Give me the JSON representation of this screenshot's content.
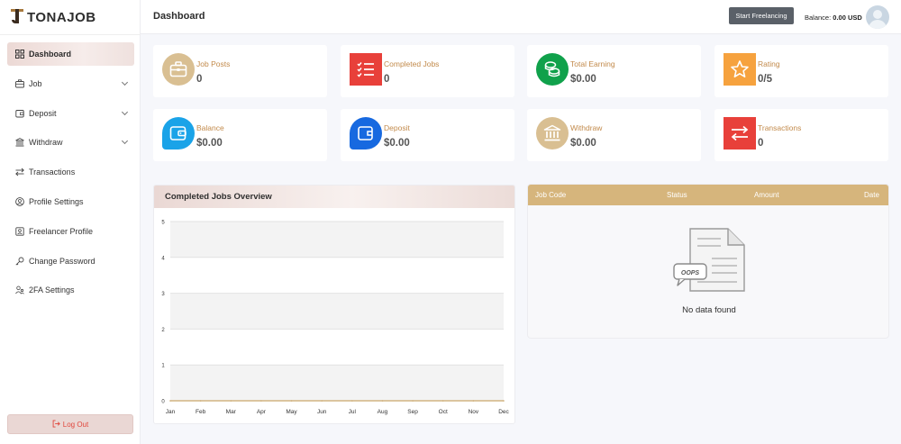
{
  "app": {
    "logo_text": "TONAJOB"
  },
  "header": {
    "title": "Dashboard",
    "start_button": "Start Freelancing",
    "balance_label": "Balance:",
    "balance_value": "0.00 USD"
  },
  "sidebar": {
    "items": [
      {
        "label": "Dashboard",
        "icon": "grid-icon"
      },
      {
        "label": "Job",
        "icon": "briefcase-icon"
      },
      {
        "label": "Deposit",
        "icon": "wallet-icon"
      },
      {
        "label": "Withdraw",
        "icon": "bank-icon"
      },
      {
        "label": "Transactions",
        "icon": "transfer-icon"
      },
      {
        "label": "Profile Settings",
        "icon": "user-circle-icon"
      },
      {
        "label": "Freelancer Profile",
        "icon": "profile-card-icon"
      },
      {
        "label": "Change Password",
        "icon": "key-icon"
      },
      {
        "label": "2FA Settings",
        "icon": "users-icon"
      }
    ],
    "logout": "Log Out"
  },
  "stats": [
    {
      "label": "Job Posts",
      "value": "0",
      "color": "#d9bf92",
      "icon": "briefcase-icon"
    },
    {
      "label": "Completed Jobs",
      "value": "0",
      "color": "#e8403a",
      "icon": "checklist-icon"
    },
    {
      "label": "Total Earning",
      "value": "$0.00",
      "color": "#10a14b",
      "icon": "coins-icon"
    },
    {
      "label": "Rating",
      "value": "0/5",
      "color": "#f6a23e",
      "icon": "star-icon"
    },
    {
      "label": "Balance",
      "value": "$0.00",
      "color": "#1aa3e8",
      "icon": "wallet-icon"
    },
    {
      "label": "Deposit",
      "value": "$0.00",
      "color": "#1769e0",
      "icon": "wallet-icon"
    },
    {
      "label": "Withdraw",
      "value": "$0.00",
      "color": "#d9bf92",
      "icon": "bank-icon"
    },
    {
      "label": "Transactions",
      "value": "0",
      "color": "#e8403a",
      "icon": "transfer-icon"
    }
  ],
  "chart": {
    "title": "Completed Jobs Overview"
  },
  "chart_data": {
    "type": "area",
    "title": "Completed Jobs Overview",
    "categories": [
      "Jan",
      "Feb",
      "Mar",
      "Apr",
      "May",
      "Jun",
      "Jul",
      "Aug",
      "Sep",
      "Oct",
      "Nov",
      "Dec"
    ],
    "values": [
      0,
      0,
      0,
      0,
      0,
      0,
      0,
      0,
      0,
      0,
      0,
      0
    ],
    "yticks": [
      "0",
      "1",
      "2",
      "3",
      "4",
      "5"
    ],
    "ylim": [
      0,
      5
    ],
    "grid": true
  },
  "table": {
    "columns": [
      "Job Code",
      "Status",
      "Amount",
      "Date"
    ],
    "illustration_text": "OOPS",
    "empty_text": "No data found",
    "header_color": "#d6b57c"
  }
}
